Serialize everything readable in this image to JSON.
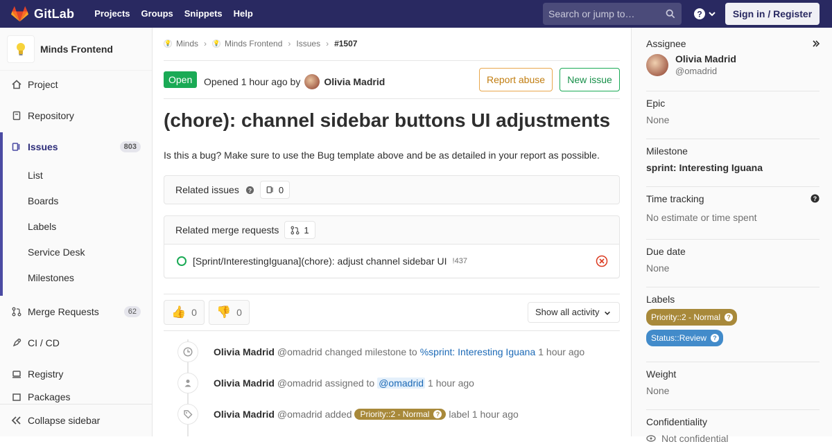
{
  "topbar": {
    "brand": "GitLab",
    "nav": [
      "Projects",
      "Groups",
      "Snippets",
      "Help"
    ],
    "search_placeholder": "Search or jump to…",
    "signin_label": "Sign in / Register"
  },
  "sidebar": {
    "project_name": "Minds Frontend",
    "items": [
      {
        "label": "Project"
      },
      {
        "label": "Repository"
      },
      {
        "label": "Issues",
        "count": "803"
      },
      {
        "label": "Merge Requests",
        "count": "62"
      },
      {
        "label": "CI / CD"
      },
      {
        "label": "Registry"
      },
      {
        "label": "Packages"
      }
    ],
    "issue_subitems": [
      "List",
      "Boards",
      "Labels",
      "Service Desk",
      "Milestones"
    ],
    "collapse_label": "Collapse sidebar"
  },
  "breadcrumb": [
    "Minds",
    "Minds Frontend",
    "Issues",
    "#1507"
  ],
  "issue": {
    "status": "Open",
    "opened_text": "Opened 1 hour ago by",
    "author": "Olivia Madrid",
    "report_abuse_label": "Report abuse",
    "new_issue_label": "New issue",
    "title": "(chore): channel sidebar buttons UI adjustments",
    "description": "Is this a bug? Make sure to use the Bug template above and be as detailed in your report as possible."
  },
  "related_issues": {
    "label": "Related issues",
    "count": "0"
  },
  "related_mrs": {
    "label": "Related merge requests",
    "count": "1",
    "items": [
      {
        "title": "[Sprint/InterestingIguana](chore): adjust channel sidebar UI",
        "ref": "!437"
      }
    ]
  },
  "awards": {
    "thumbs_up": "0",
    "thumbs_down": "0"
  },
  "activity_filter": "Show all activity",
  "notes": [
    {
      "author": "Olivia Madrid",
      "handle": "@omadrid",
      "action": "changed milestone to",
      "link": "%sprint: Interesting Iguana",
      "time": "1 hour ago"
    },
    {
      "author": "Olivia Madrid",
      "handle": "@omadrid",
      "action": "assigned to",
      "link": "@omadrid",
      "time": "1 hour ago"
    },
    {
      "author": "Olivia Madrid",
      "handle": "@omadrid",
      "action": "added",
      "label": "Priority::2 - Normal",
      "suffix": "label",
      "time": "1 hour ago"
    }
  ],
  "right_sidebar": {
    "assignee": {
      "title": "Assignee",
      "name": "Olivia Madrid",
      "handle": "@omadrid"
    },
    "epic": {
      "title": "Epic",
      "value": "None"
    },
    "milestone": {
      "title": "Milestone",
      "value": "sprint: Interesting Iguana"
    },
    "time_tracking": {
      "title": "Time tracking",
      "value": "No estimate or time spent"
    },
    "due_date": {
      "title": "Due date",
      "value": "None"
    },
    "labels": {
      "title": "Labels",
      "items": [
        {
          "name": "Priority::2 - Normal",
          "color": "#a8893a"
        },
        {
          "name": "Status::Review",
          "color": "#428bca"
        }
      ]
    },
    "weight": {
      "title": "Weight",
      "value": "None"
    },
    "confidentiality": {
      "title": "Confidentiality",
      "value": "Not confidential"
    }
  },
  "colors": {
    "navbar": "#292961",
    "open": "#1aaa55",
    "report": "#e9a74c",
    "link": "#1b69b6"
  }
}
